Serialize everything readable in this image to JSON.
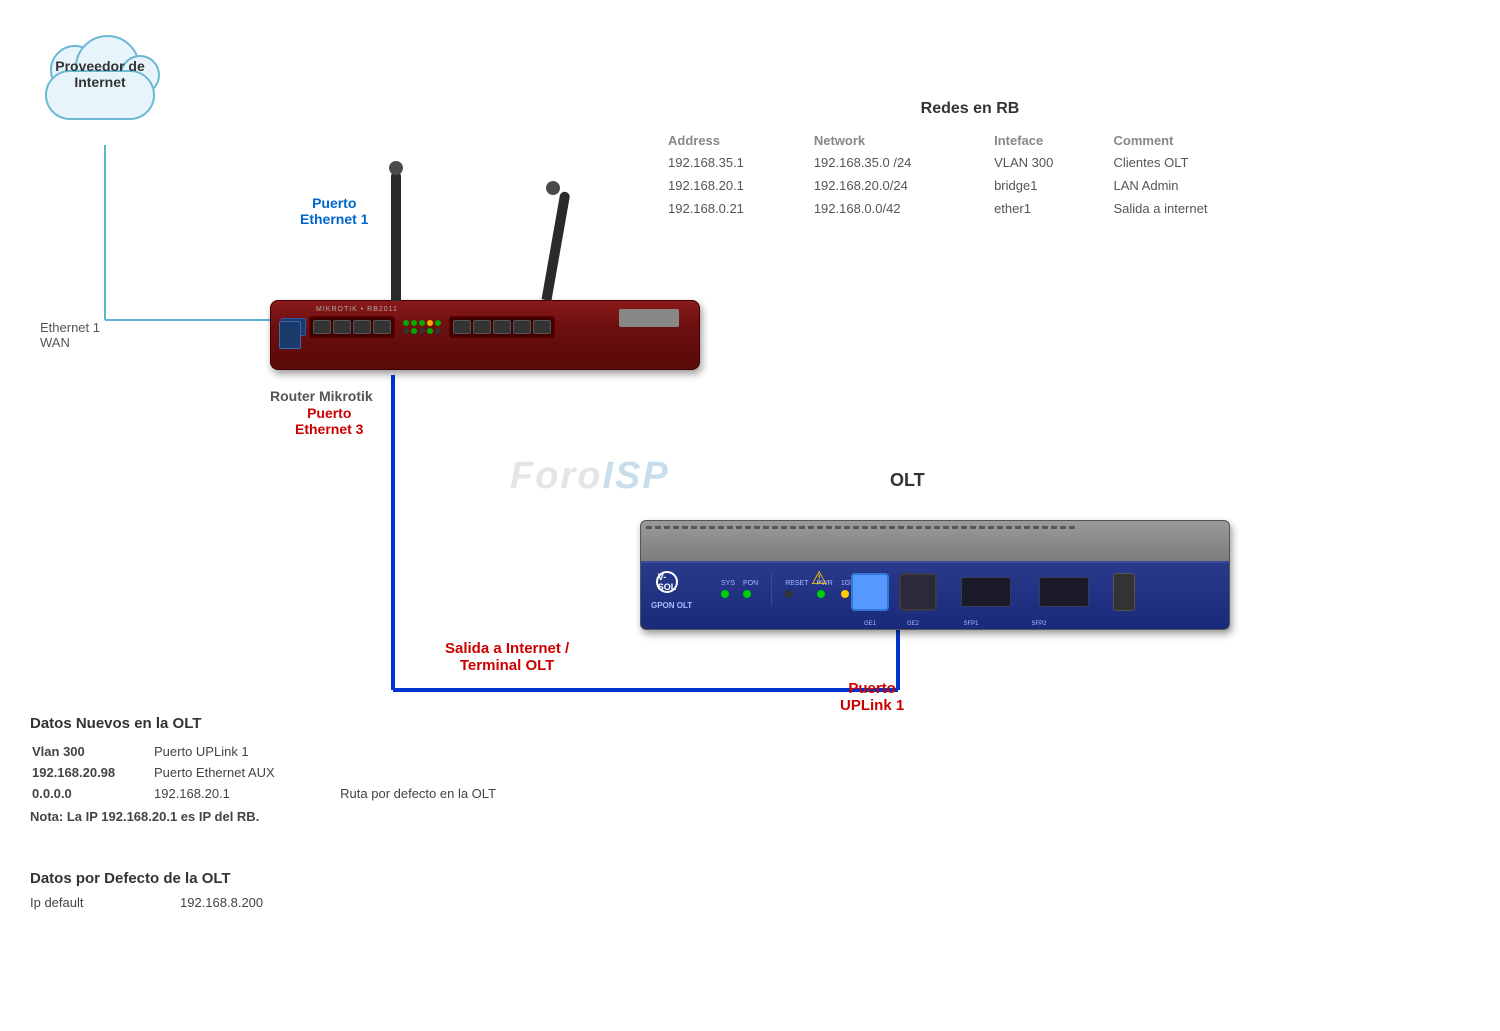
{
  "cloud": {
    "label_line1": "Proveedor de",
    "label_line2": "Internet"
  },
  "labels": {
    "eth1_wan_line1": "Ethernet 1",
    "eth1_wan_line2": "WAN",
    "puerto_eth1_line1": "Puerto",
    "puerto_eth1_line2": "Ethernet 1",
    "puerto_eth3_line1": "Puerto",
    "puerto_eth3_line2": "Ethernet 3",
    "router_label": "Router Mikrotik",
    "olt_title": "OLT",
    "salida_line1": "Salida a Internet /",
    "salida_line2": "Terminal  OLT",
    "uplink_line1": "Puerto",
    "uplink_line2": "UPLink 1",
    "watermark": "Foro",
    "watermark2": "ISP"
  },
  "network_table": {
    "title": "Redes en RB",
    "headers": [
      "Address",
      "Network",
      "Inteface",
      "Comment"
    ],
    "rows": [
      [
        "192.168.35.1",
        "192.168.35.0 /24",
        "VLAN 300",
        "Clientes OLT"
      ],
      [
        "192.168.20.1",
        "192.168.20.0/24",
        "bridge1",
        "LAN Admin"
      ],
      [
        "192.168.0.21",
        "192.168.0.0/42",
        "ether1",
        "Salida a internet"
      ]
    ]
  },
  "olt_data": {
    "title": "Datos Nuevos en  la OLT",
    "rows": [
      {
        "col1": "Vlan 300",
        "col2": "Puerto UPLink 1"
      },
      {
        "col1": "192.168.20.98",
        "col2": "Puerto Ethernet AUX"
      },
      {
        "col1": "0.0.0.0",
        "col2": "192.168.20.1",
        "col3": "Ruta  por defecto en la OLT"
      }
    ],
    "note": "Nota: La IP 192.168.20.1 es IP del RB."
  },
  "default_data": {
    "title": "Datos por Defecto de la OLT",
    "ip_label": "Ip default",
    "ip_value": "192.168.8.200"
  },
  "vsol": {
    "logo": "V-SOL",
    "model": "GPON OLT"
  }
}
